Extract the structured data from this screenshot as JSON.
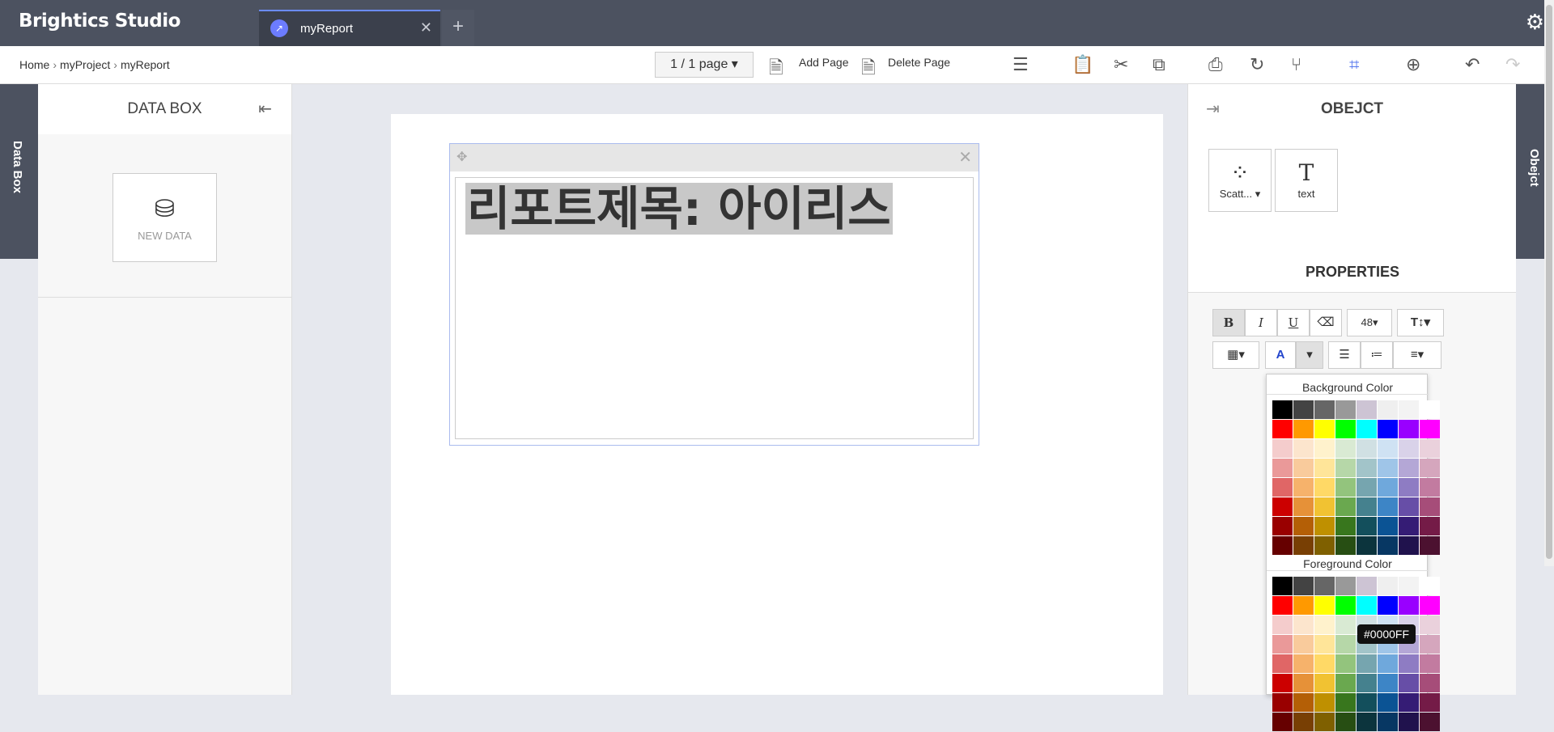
{
  "app": {
    "brand": "Brightics Studio"
  },
  "tabs": [
    {
      "label": "myReport"
    }
  ],
  "breadcrumb": {
    "items": [
      "Home",
      "myProject",
      "myReport"
    ]
  },
  "toolbar": {
    "page_select": "1 / 1 page",
    "add_page": "Add Page",
    "delete_page": "Delete Page"
  },
  "databox": {
    "title": "DATA BOX",
    "new_data": "NEW DATA",
    "side_label": "Data Box"
  },
  "canvas": {
    "heading": "리포트제목: 아이리스"
  },
  "object_panel": {
    "title": "OBEJCT",
    "side_label": "Obejct",
    "objects": [
      {
        "label": "Scatt..."
      },
      {
        "label": "text"
      }
    ],
    "properties_title": "PROPERTIES",
    "font_size": "48"
  },
  "color_picker": {
    "background_title": "Background Color",
    "foreground_title": "Foreground Color",
    "tooltip": "#0000FF",
    "palette": [
      [
        "#000000",
        "#434343",
        "#666666",
        "#999999",
        "#cdc4d4",
        "#efefef",
        "#f3f3f3",
        "#ffffff"
      ],
      [
        "#ff0000",
        "#ff9900",
        "#ffff00",
        "#00ff00",
        "#00ffff",
        "#0000ff",
        "#9900ff",
        "#ff00ff"
      ],
      [
        "#f4cccc",
        "#fce5cd",
        "#fff2cc",
        "#d9ead3",
        "#d0e0e3",
        "#cfe2f3",
        "#d9d2e9",
        "#ead1dc"
      ],
      [
        "#ea9999",
        "#f9cb9c",
        "#ffe599",
        "#b6d7a8",
        "#a2c4c9",
        "#9fc5e8",
        "#b4a7d6",
        "#d5a6bd"
      ],
      [
        "#e06666",
        "#f6b26b",
        "#ffd966",
        "#93c47d",
        "#76a5af",
        "#6fa8dc",
        "#8e7cc3",
        "#c27ba0"
      ],
      [
        "#cc0000",
        "#e69138",
        "#f1c232",
        "#6aa84f",
        "#45818e",
        "#3d85c6",
        "#674ea7",
        "#a64d79"
      ],
      [
        "#990000",
        "#b45f06",
        "#bf9000",
        "#38761d",
        "#134f5c",
        "#0b5394",
        "#351c75",
        "#741b47"
      ],
      [
        "#660000",
        "#783f04",
        "#7f6000",
        "#274e13",
        "#0c343d",
        "#073763",
        "#20124d",
        "#4c1130"
      ]
    ]
  }
}
